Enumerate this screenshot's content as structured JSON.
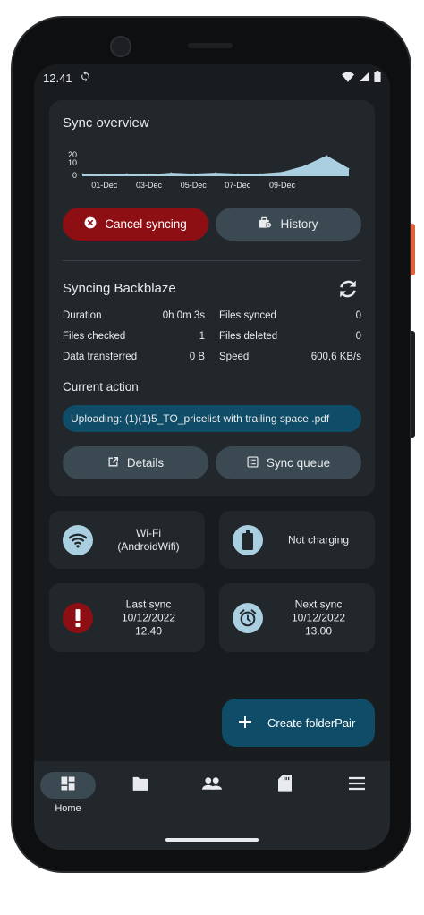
{
  "status_bar": {
    "time": "12.41"
  },
  "sync_overview": {
    "title": "Sync overview",
    "chart_data": {
      "type": "area",
      "x": [
        "30-Nov",
        "01-Dec",
        "02-Dec",
        "03-Dec",
        "04-Dec",
        "05-Dec",
        "06-Dec",
        "07-Dec",
        "08-Dec",
        "09-Dec",
        "10-Dec",
        "11-Dec",
        "12-Dec"
      ],
      "values": [
        3,
        2,
        3,
        2,
        4,
        3,
        4,
        3,
        3,
        5,
        12,
        24,
        9
      ],
      "tick_labels": [
        "01-Dec",
        "03-Dec",
        "05-Dec",
        "07-Dec",
        "09-Dec"
      ],
      "y_ticks": [
        "20",
        "10",
        "0"
      ],
      "ylim": [
        0,
        28
      ],
      "color": "#a9cfe0"
    },
    "cancel_label": "Cancel syncing",
    "history_label": "History"
  },
  "syncing": {
    "title": "Syncing Backblaze",
    "stats": {
      "duration_label": "Duration",
      "duration_value": "0h 0m 3s",
      "files_synced_label": "Files synced",
      "files_synced_value": "0",
      "files_checked_label": "Files checked",
      "files_checked_value": "1",
      "files_deleted_label": "Files deleted",
      "files_deleted_value": "0",
      "data_transferred_label": "Data transferred",
      "data_transferred_value": "0 B",
      "speed_label": "Speed",
      "speed_value": "600,6 KB/s"
    },
    "current_action_label": "Current action",
    "current_action_text": "Uploading: (1)(1)5_TO_pricelist with trailing space .pdf",
    "details_label": "Details",
    "sync_queue_label": "Sync queue"
  },
  "tiles": {
    "wifi_line1": "Wi-Fi",
    "wifi_line2": "(AndroidWifi)",
    "charging": "Not charging",
    "last_sync_title": "Last sync",
    "last_sync_date": "10/12/2022",
    "last_sync_time": "12.40",
    "next_sync_title": "Next sync",
    "next_sync_date": "10/12/2022",
    "next_sync_time": "13.00"
  },
  "fab": {
    "label": "Create folderPair"
  },
  "nav": {
    "home_label": "Home"
  },
  "colors": {
    "accent": "#0f4c67",
    "danger": "#8e0f13",
    "chart_fill": "#a9cfe0",
    "surface": "#22272b",
    "background": "#191c1f"
  }
}
